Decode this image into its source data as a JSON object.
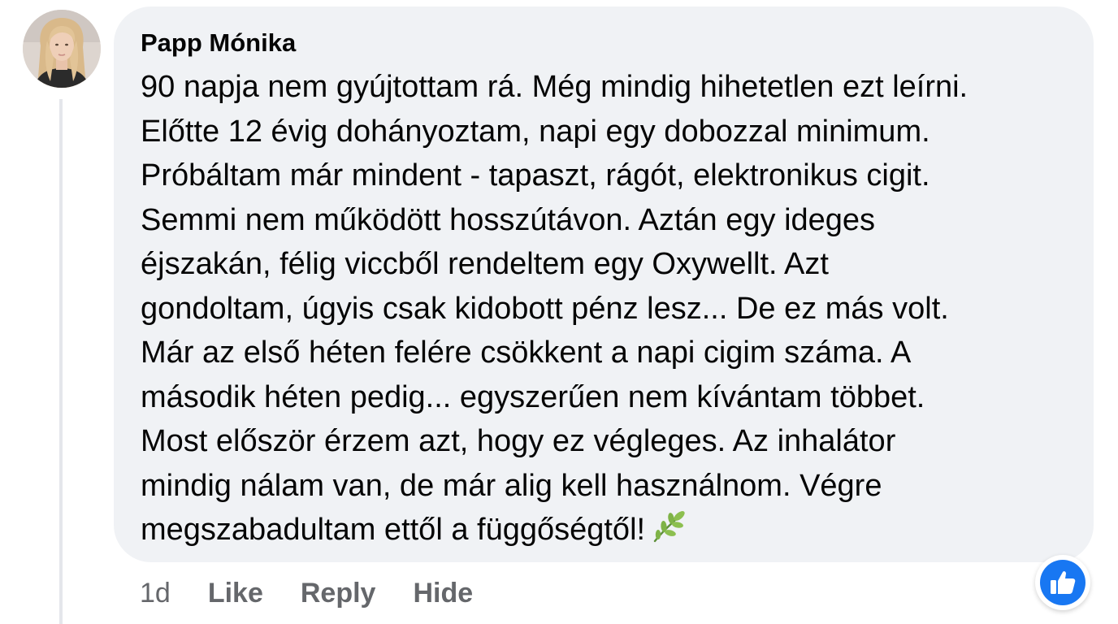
{
  "comment": {
    "author": "Papp Mónika",
    "text": "90 napja nem gyújtottam rá. Még mindig hihetetlen ezt leírni.\nElőtte 12 évig dohányoztam, napi egy dobozzal minimum.\nPróbáltam már mindent - tapaszt, rágót, elektronikus cigit.\nSemmi nem működött hosszútávon. Aztán egy ideges\néjszakán, félig viccből rendeltem egy Oxywellt. Azt\ngondoltam, úgyis csak kidobott pénz lesz... De ez más volt.\nMár az első héten felére csökkent a napi cigim száma. A\nmásodik héten pedig... egyszerűen nem kívántam többet.\nMost először érzem azt, hogy ez végleges. Az inhalátor\nmindig nálam van, de már alig kell használnom. Végre\nmegszabadultam ettől a függőségtől!",
    "emoji_icon": "herb-leaf-icon"
  },
  "actions": {
    "time": "1d",
    "like": "Like",
    "reply": "Reply",
    "hide": "Hide"
  },
  "reaction": {
    "icon": "thumbs-up-icon",
    "color": "#1877f2"
  },
  "colors": {
    "bubble": "#f0f2f5",
    "text": "#050505",
    "secondary": "#65676b"
  }
}
